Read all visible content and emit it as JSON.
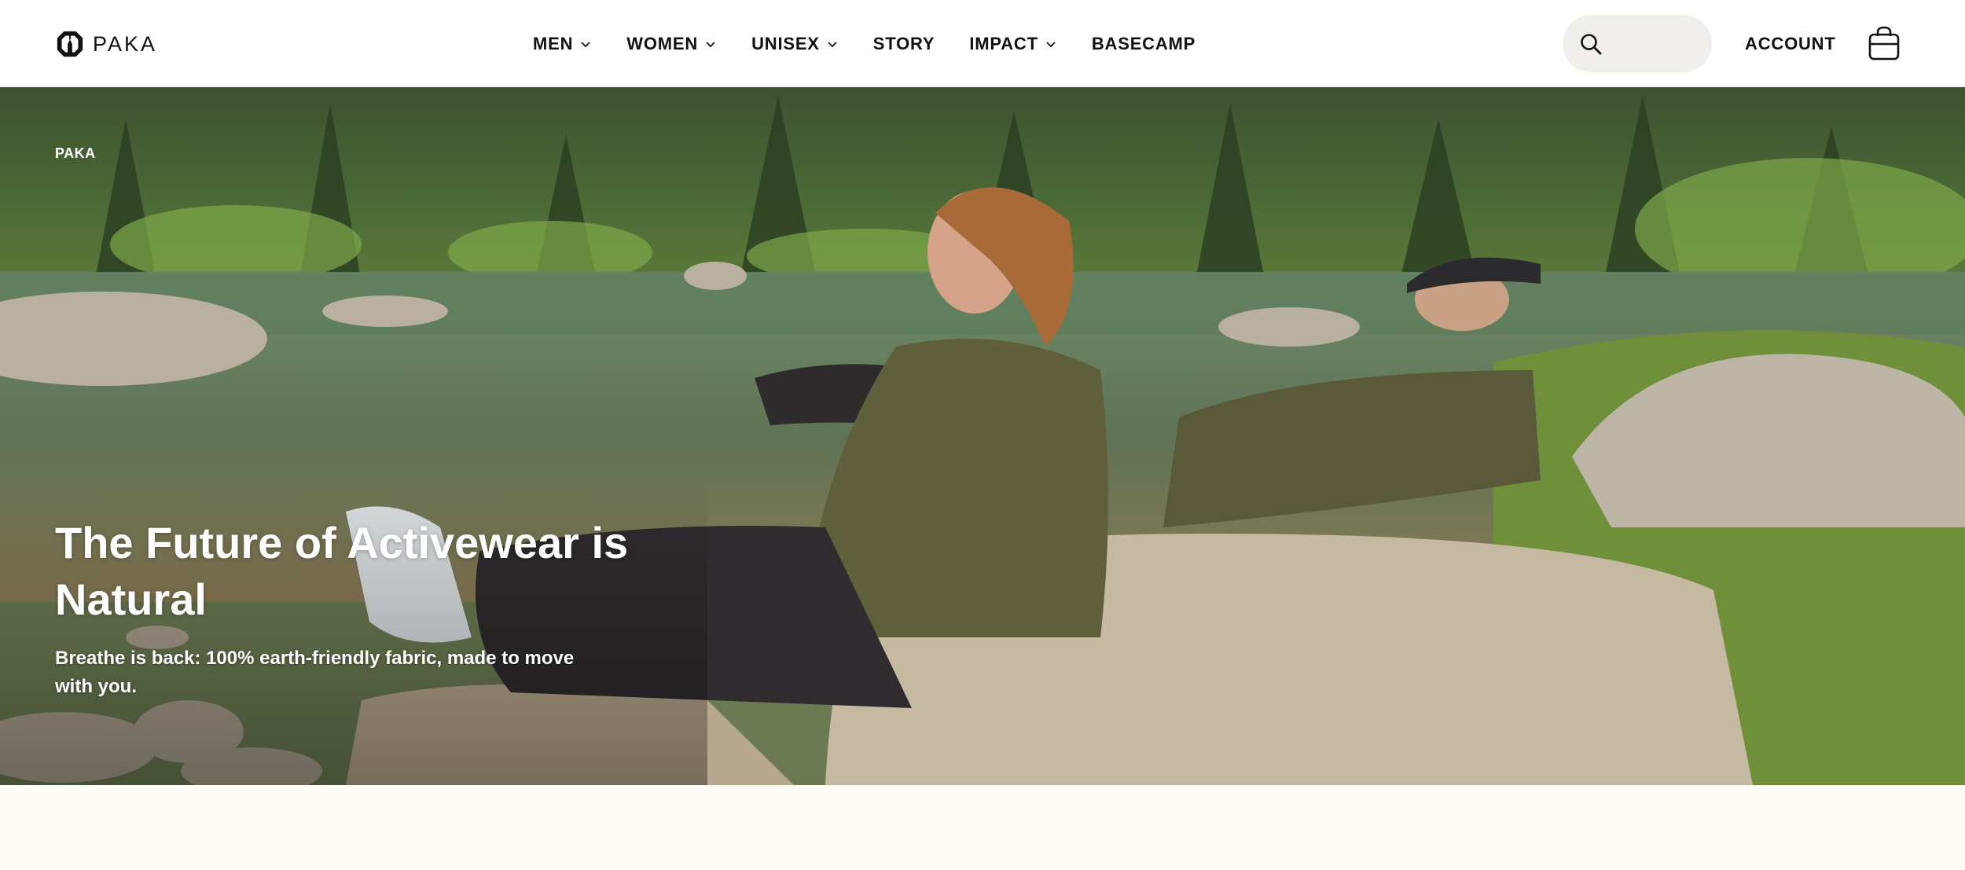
{
  "brand": {
    "logo_text": "PAKA",
    "logo_icon": "paka-mountain-logo-icon"
  },
  "nav": {
    "items": [
      {
        "label": "MEN",
        "has_dropdown": true
      },
      {
        "label": "WOMEN",
        "has_dropdown": true
      },
      {
        "label": "UNISEX",
        "has_dropdown": true
      },
      {
        "label": "STORY",
        "has_dropdown": false
      },
      {
        "label": "IMPACT",
        "has_dropdown": true
      },
      {
        "label": "BASECAMP",
        "has_dropdown": false
      }
    ]
  },
  "header_actions": {
    "search_icon": "search-icon",
    "search_placeholder": "",
    "account_label": "ACCOUNT",
    "cart_icon": "shopping-bag-icon"
  },
  "hero": {
    "eyebrow": "PAKA",
    "title": "The Future of Activewear is Natural",
    "subtitle": "Breathe is back: 100% earth-friendly fabric, made to move with you."
  },
  "colors": {
    "header_bg": "#ffffff",
    "page_bg": "#fefcf6",
    "text_dark": "#111111",
    "search_bg": "#f1efeb",
    "hero_text": "#ffffff"
  }
}
